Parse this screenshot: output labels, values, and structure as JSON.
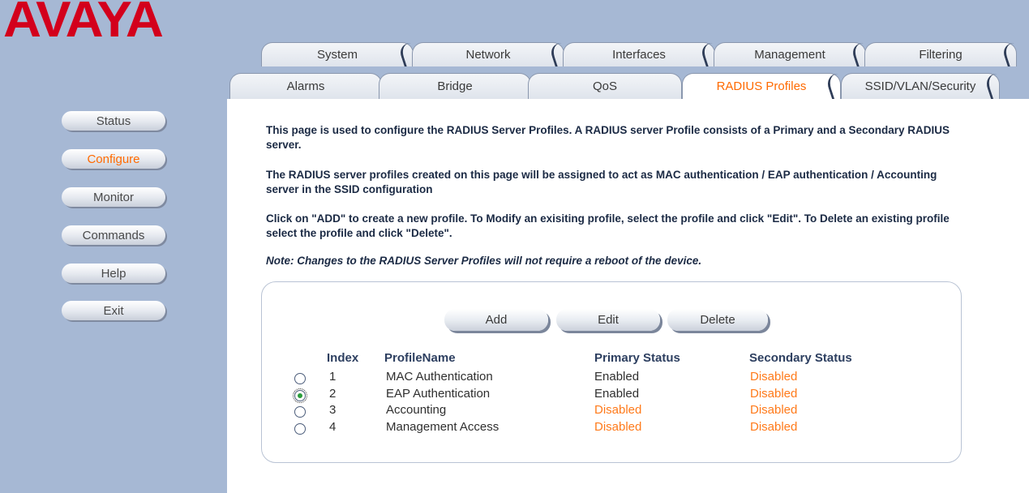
{
  "brand": {
    "logo_text": "AVAYA",
    "logo_color": "#d3001c"
  },
  "tabs": {
    "row1": [
      "System",
      "Network",
      "Interfaces",
      "Management",
      "Filtering"
    ],
    "row2": [
      "Alarms",
      "Bridge",
      "QoS",
      "RADIUS Profiles",
      "SSID/VLAN/Security"
    ],
    "active": "RADIUS Profiles"
  },
  "sidebar": {
    "items": [
      "Status",
      "Configure",
      "Monitor",
      "Commands",
      "Help",
      "Exit"
    ],
    "active": "Configure"
  },
  "content": {
    "para1": "This page is used to configure the RADIUS Server Profiles. A RADIUS server Profile consists of a Primary and a Secondary RADIUS server.",
    "para2": "The RADIUS server profiles created on this page will be assigned to act as MAC authentication / EAP authentication / Accounting server in the SSID configuration",
    "para3": "Click on \"ADD\" to create a new profile. To Modify an exisiting profile, select the profile and click \"Edit\". To Delete an existing profile select the profile and click \"Delete\".",
    "note": "Note: Changes to the RADIUS Server Profiles will not require a reboot of the device."
  },
  "actions": {
    "add": "Add",
    "edit": "Edit",
    "delete": "Delete"
  },
  "table": {
    "headers": {
      "index": "Index",
      "name": "ProfileName",
      "primary": "Primary Status",
      "secondary": "Secondary Status"
    },
    "rows": [
      {
        "index": "1",
        "name": "MAC Authentication",
        "primary": "Enabled",
        "secondary": "Disabled",
        "selected": false
      },
      {
        "index": "2",
        "name": "EAP Authentication",
        "primary": "Enabled",
        "secondary": "Disabled",
        "selected": true
      },
      {
        "index": "3",
        "name": "Accounting",
        "primary": "Disabled",
        "secondary": "Disabled",
        "selected": false
      },
      {
        "index": "4",
        "name": "Management Access",
        "primary": "Disabled",
        "secondary": "Disabled",
        "selected": false
      }
    ]
  },
  "colors": {
    "accent": "#ff6a00",
    "disabled": "#ff7a1a",
    "sidebar_bg": "#a6b8d4"
  }
}
